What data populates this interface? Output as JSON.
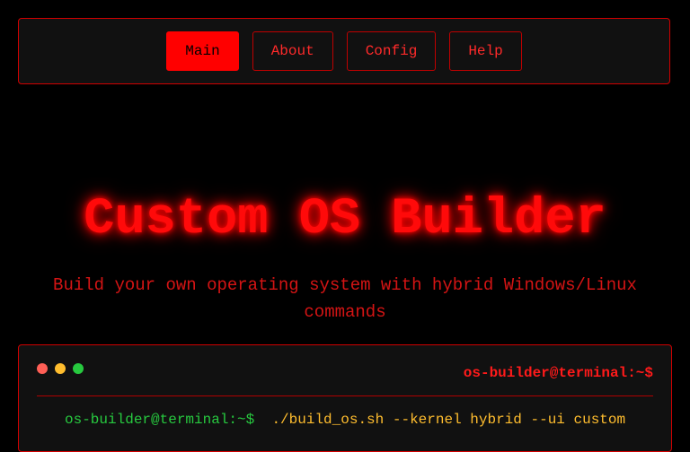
{
  "nav": {
    "items": [
      {
        "label": "Main",
        "active": true
      },
      {
        "label": "About",
        "active": false
      },
      {
        "label": "Config",
        "active": false
      },
      {
        "label": "Help",
        "active": false
      }
    ]
  },
  "hero": {
    "title": "Custom OS Builder",
    "subtitle": "Build your own operating system with hybrid Windows/Linux commands"
  },
  "terminal": {
    "title": "os-builder@terminal:~$",
    "prompt": "os-builder@terminal:~$",
    "command": "./build_os.sh --kernel hybrid --ui custom"
  },
  "colors": {
    "accent": "#ff0000",
    "background": "#000000",
    "panel": "#111111",
    "prompt": "#27c93f",
    "command": "#ffbd2e",
    "dot_red": "#ff5f56",
    "dot_yellow": "#ffbd2e",
    "dot_green": "#27c93f"
  }
}
